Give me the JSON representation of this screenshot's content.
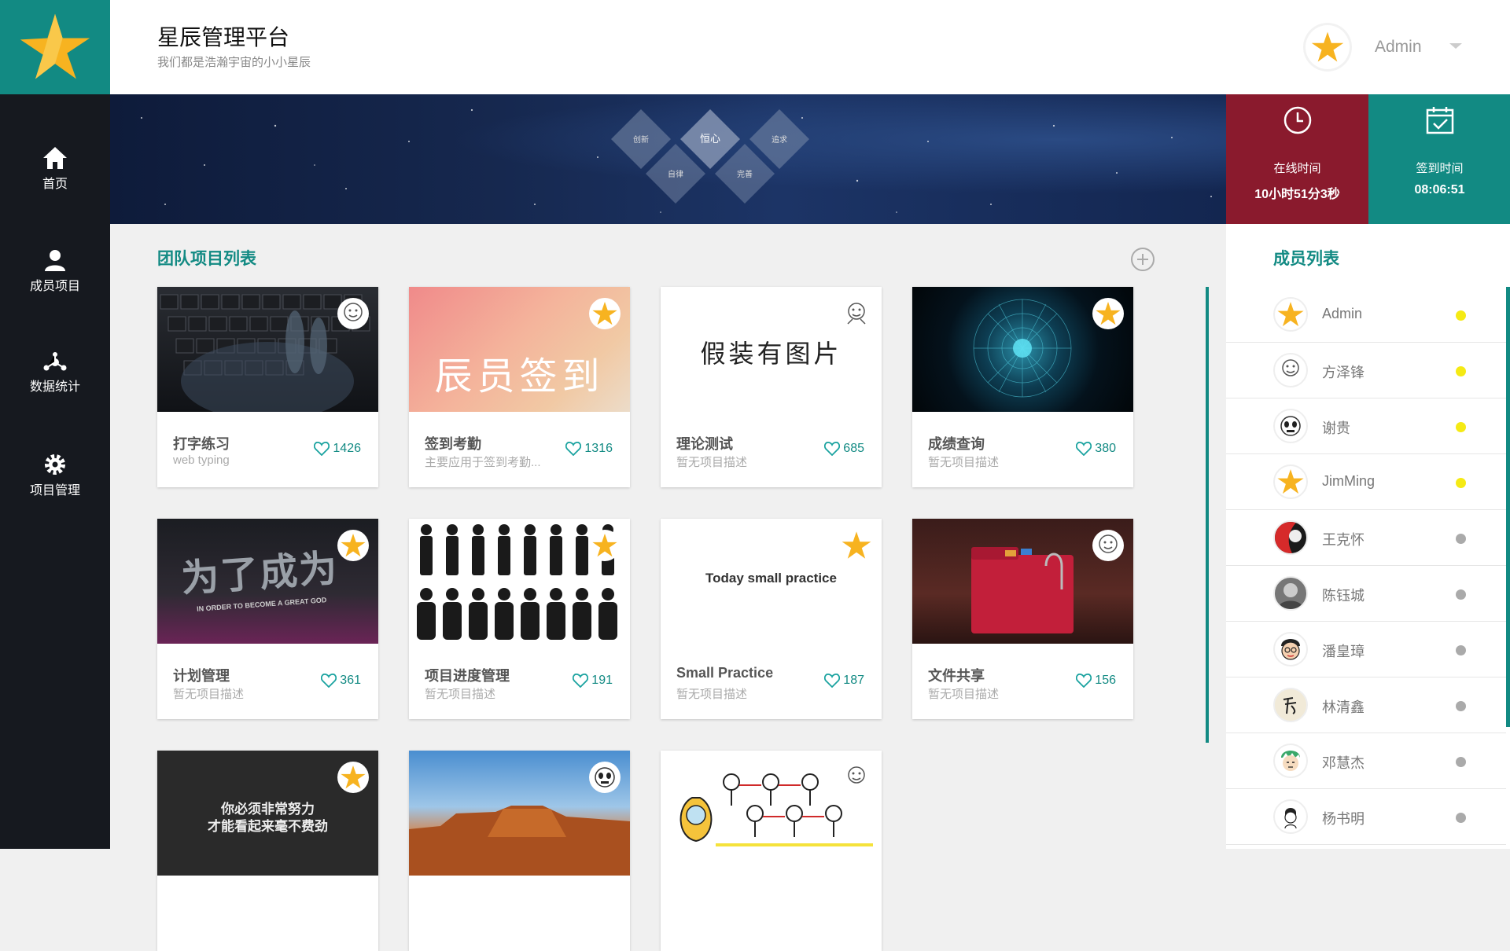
{
  "header": {
    "title": "星辰管理平台",
    "subtitle": "我们都是浩瀚宇宙的小小星辰",
    "user": "Admin"
  },
  "sidebar": {
    "items": [
      {
        "label": "首页",
        "icon": "home-icon"
      },
      {
        "label": "成员项目",
        "icon": "user-icon"
      },
      {
        "label": "数据统计",
        "icon": "network-icon"
      },
      {
        "label": "项目管理",
        "icon": "gear-icon"
      }
    ]
  },
  "banner": {
    "diamonds": [
      "创新",
      "恒心",
      "追求",
      "自律",
      "完善"
    ]
  },
  "stats": {
    "online": {
      "label": "在线时间",
      "value": "10小时51分3秒"
    },
    "checkin": {
      "label": "签到时间",
      "value": "08:06:51"
    }
  },
  "projects": {
    "title": "团队项目列表",
    "items": [
      {
        "title": "打字练习",
        "desc": "web typing",
        "likes": "1426",
        "image_text": ""
      },
      {
        "title": "签到考勤",
        "desc": "主要应用于签到考勤...",
        "likes": "1316",
        "image_text": "辰员签到"
      },
      {
        "title": "理论测试",
        "desc": "暂无项目描述",
        "likes": "685",
        "image_text": "假装有图片"
      },
      {
        "title": "成绩查询",
        "desc": "暂无项目描述",
        "likes": "380",
        "image_text": ""
      },
      {
        "title": "计划管理",
        "desc": "暂无项目描述",
        "likes": "361",
        "image_text": "为了成为",
        "image_sub": "IN ORDER TO BECOME A GREAT GOD"
      },
      {
        "title": "项目进度管理",
        "desc": "暂无项目描述",
        "likes": "191",
        "image_text": ""
      },
      {
        "title": "Small Practice",
        "desc": "暂无项目描述",
        "likes": "187",
        "image_text": "Today small practice"
      },
      {
        "title": "文件共享",
        "desc": "暂无项目描述",
        "likes": "156",
        "image_text": ""
      },
      {
        "title": "",
        "desc": "",
        "likes": "",
        "image_text": "你必须非常努力",
        "image_sub": "才能看起来毫不费劲"
      },
      {
        "title": "",
        "desc": "",
        "likes": "",
        "image_text": ""
      },
      {
        "title": "",
        "desc": "",
        "likes": "",
        "image_text": ""
      }
    ]
  },
  "members": {
    "title": "成员列表",
    "items": [
      {
        "name": "Admin",
        "status": "online"
      },
      {
        "name": "方泽锋",
        "status": "online"
      },
      {
        "name": "谢贵",
        "status": "online"
      },
      {
        "name": "JimMing",
        "status": "online"
      },
      {
        "name": "王克怀",
        "status": "offline"
      },
      {
        "name": "陈钰城",
        "status": "offline"
      },
      {
        "name": "潘皇璋",
        "status": "offline"
      },
      {
        "name": "林清鑫",
        "status": "offline"
      },
      {
        "name": "邓慧杰",
        "status": "offline"
      },
      {
        "name": "杨书明",
        "status": "offline"
      }
    ]
  },
  "colors": {
    "accent": "#128a83",
    "sidebar": "#16191f",
    "online_stat": "#8a1a2d",
    "online_dot": "#f5ea14",
    "offline_dot": "#aaaaaa",
    "star": "#f7b320"
  }
}
